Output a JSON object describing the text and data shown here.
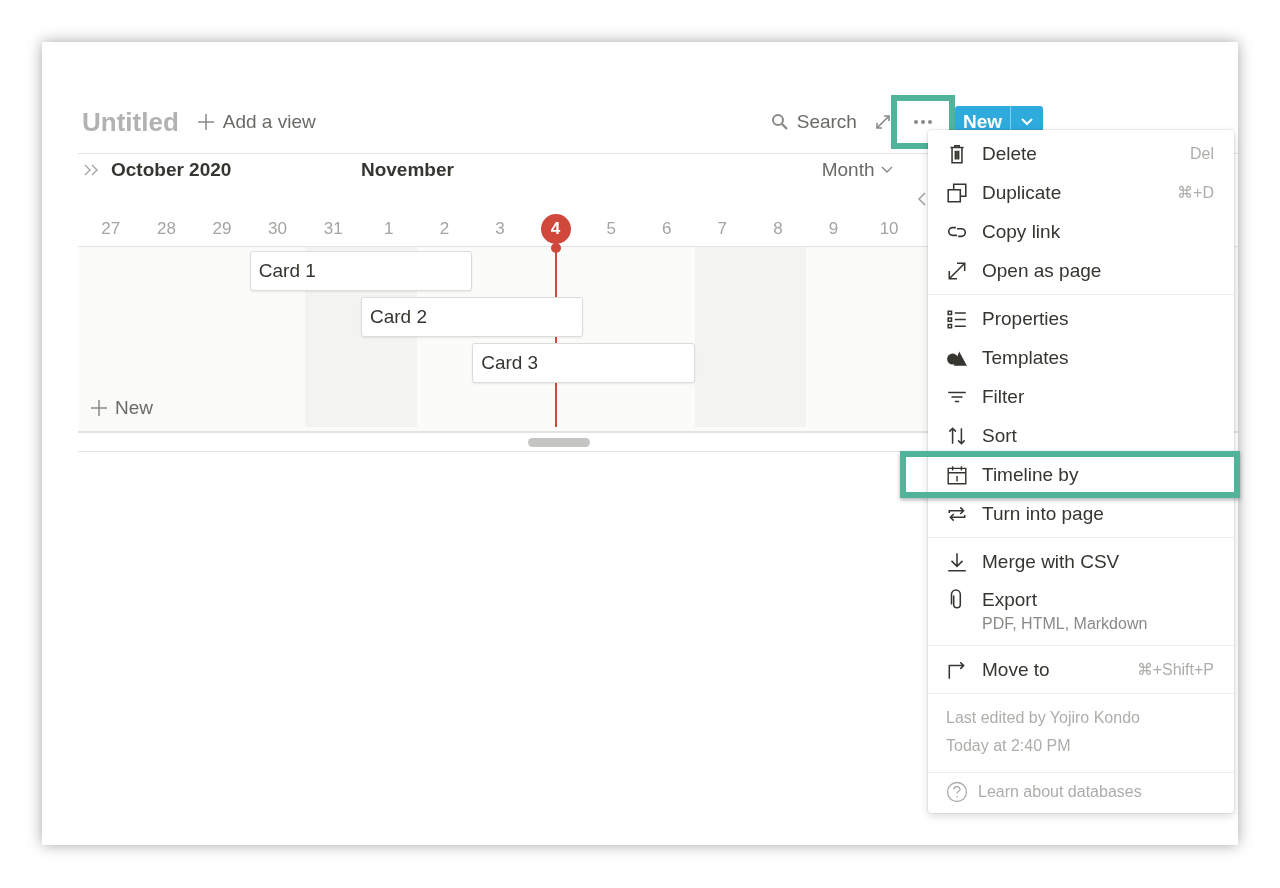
{
  "view": {
    "title": "Untitled",
    "add_view": "Add a view"
  },
  "toolbar": {
    "search": "Search",
    "more": {
      "annotated": true
    },
    "new_button": "New"
  },
  "timeline": {
    "month_left": "October 2020",
    "month_mid": "November",
    "zoom": "Month",
    "days": [
      {
        "label": "27",
        "today": false,
        "weekend": false
      },
      {
        "label": "28",
        "today": false,
        "weekend": false
      },
      {
        "label": "29",
        "today": false,
        "weekend": false
      },
      {
        "label": "30",
        "today": false,
        "weekend": false
      },
      {
        "label": "31",
        "today": false,
        "weekend": true
      },
      {
        "label": "1",
        "today": false,
        "weekend": true
      },
      {
        "label": "2",
        "today": false,
        "weekend": false
      },
      {
        "label": "3",
        "today": false,
        "weekend": false
      },
      {
        "label": "4",
        "today": true,
        "weekend": false
      },
      {
        "label": "5",
        "today": false,
        "weekend": false
      },
      {
        "label": "6",
        "today": false,
        "weekend": false
      },
      {
        "label": "7",
        "today": false,
        "weekend": true
      },
      {
        "label": "8",
        "today": false,
        "weekend": true
      },
      {
        "label": "9",
        "today": false,
        "weekend": false
      },
      {
        "label": "10",
        "today": false,
        "weekend": false
      }
    ],
    "cards": [
      {
        "title": "Card 1"
      },
      {
        "title": "Card 2"
      },
      {
        "title": "Card 3"
      }
    ],
    "new_row": "New"
  },
  "menu": {
    "sections": [
      {
        "items": [
          {
            "label": "Delete",
            "shortcut": "Del",
            "annotated": false
          },
          {
            "label": "Duplicate",
            "shortcut": "⌘+D",
            "annotated": false
          },
          {
            "label": "Copy link",
            "annotated": false
          },
          {
            "label": "Open as page",
            "annotated": false
          }
        ]
      },
      {
        "items": [
          {
            "label": "Properties",
            "annotated": false
          },
          {
            "label": "Templates",
            "annotated": false
          },
          {
            "label": "Filter",
            "annotated": false
          },
          {
            "label": "Sort",
            "annotated": false
          },
          {
            "label": "Timeline by",
            "annotated": true
          },
          {
            "label": "Turn into page",
            "annotated": false
          }
        ]
      },
      {
        "items": [
          {
            "label": "Merge with CSV",
            "annotated": false
          },
          {
            "label": "Export",
            "subtitle": "PDF, HTML, Markdown",
            "annotated": false
          }
        ]
      },
      {
        "items": [
          {
            "label": "Move to",
            "shortcut": "⌘+Shift+P",
            "annotated": false
          }
        ]
      }
    ],
    "last_edited": "Last edited by Yojiro Kondo",
    "edited_time": "Today at 2:40 PM",
    "help": "Learn about databases"
  }
}
